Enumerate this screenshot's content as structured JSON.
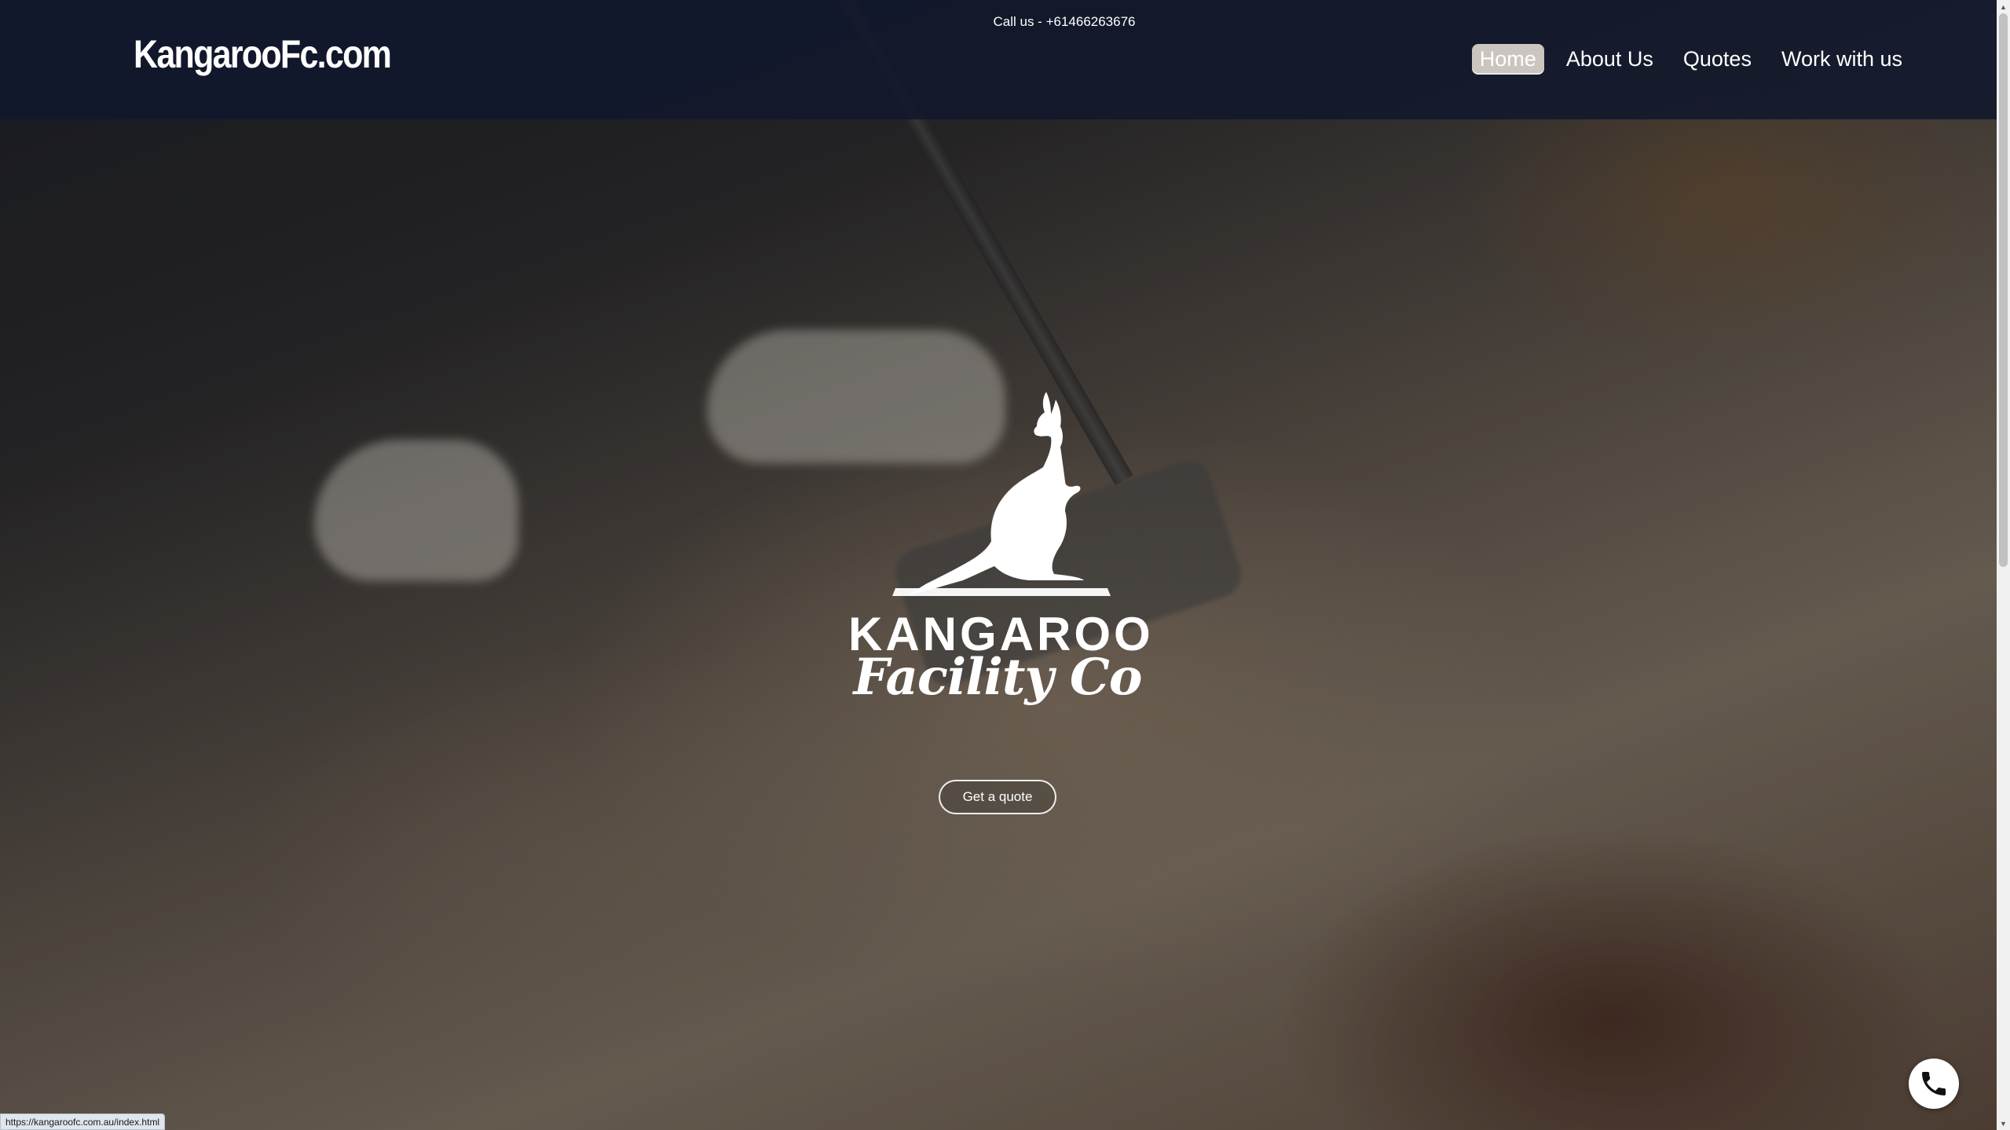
{
  "header": {
    "brand": "KangarooFc.com",
    "call_text": "Call us - +61466263676",
    "nav": [
      {
        "label": "Home",
        "active": true
      },
      {
        "label": "About Us",
        "active": false
      },
      {
        "label": "Quotes",
        "active": false
      },
      {
        "label": "Work with us",
        "active": false
      }
    ]
  },
  "hero": {
    "logo_line1": "KANGAROO",
    "logo_line2": "Facility Co",
    "cta_label": "Get a quote"
  },
  "fab": {
    "icon": "phone-icon"
  },
  "status_bar": {
    "url": "https://kangaroofc.com.au/index.html"
  },
  "colors": {
    "header_bg": "#11182c",
    "text": "#ffffff",
    "active_nav_bg": "#ebe4da"
  }
}
